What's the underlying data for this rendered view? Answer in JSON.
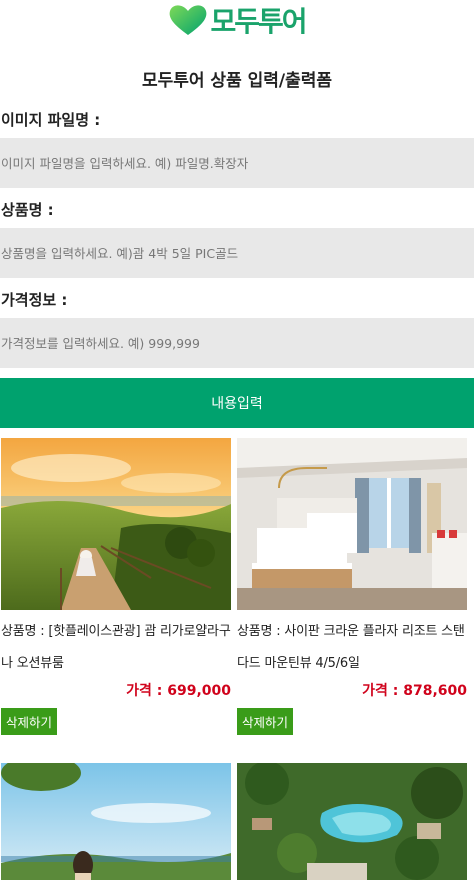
{
  "header": {
    "logo_text": "모두투어",
    "title": "모두투어 상품 입력/출력폼"
  },
  "form": {
    "image_label": "이미지 파일명 :",
    "image_placeholder": "이미지 파일명을 입력하세요. 예) 파일명.확장자",
    "name_label": "상품명 :",
    "name_placeholder": "상품명을 입력하세요. 예)괌 4박 5일 PIC골드",
    "price_label": "가격정보 :",
    "price_placeholder": "가격정보를 입력하세요. 예) 999,999",
    "submit_label": "내용입력"
  },
  "products": [
    {
      "name": "상품명 : [핫플레이스관광] 괌 리가로얄라구나 오션뷰룸",
      "price": "가격 : 699,000",
      "delete_label": "삭제하기"
    },
    {
      "name": "상품명 : 사이판 크라운 플라자 리조트 스탠다드 마운틴뷰 4/5/6일",
      "price": "가격 : 878,600",
      "delete_label": "삭제하기"
    }
  ],
  "colors": {
    "brand_green": "#00a26e",
    "logo_green": "#1aa36b",
    "delete_green": "#3a9c19",
    "price_red": "#d0021b",
    "input_bg": "#e8e8e8"
  }
}
